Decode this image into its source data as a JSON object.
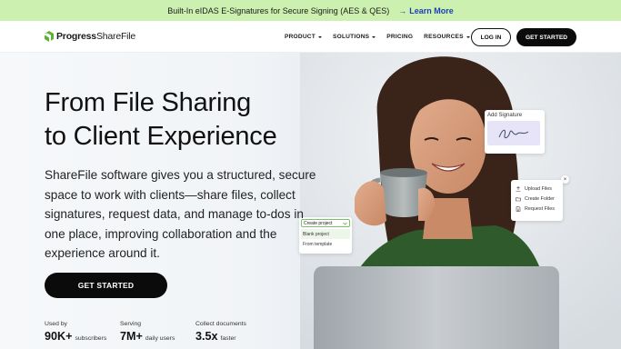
{
  "banner": {
    "message": "Built-In eIDAS E-Signatures for Secure Signing (AES & QES)",
    "link_label": "Learn More",
    "arrow": "→"
  },
  "nav": {
    "logo_primary": "Progress",
    "logo_secondary": "ShareFile",
    "menu": [
      {
        "label": "PRODUCT",
        "dropdown": true
      },
      {
        "label": "SOLUTIONS",
        "dropdown": true
      },
      {
        "label": "PRICING",
        "dropdown": false
      },
      {
        "label": "RESOURCES",
        "dropdown": true
      }
    ],
    "login_label": "LOG IN",
    "get_started_label": "GET STARTED"
  },
  "hero": {
    "headline_line1": "From File Sharing",
    "headline_line2": "to Client Experience",
    "lead": "ShareFile software gives you a structured, secure space to work with clients—share files, collect signatures, request data, and manage to-dos in one place, improving collaboration and the experience around it.",
    "cta_label": "GET STARTED",
    "stats": [
      {
        "caption": "Used by",
        "value": "90K+",
        "unit": "subscribers"
      },
      {
        "caption": "Serving",
        "value": "7M+",
        "unit": "daily users"
      },
      {
        "caption": "Collect documents",
        "value": "3.5x",
        "unit": "faster"
      }
    ]
  },
  "cards": {
    "signature": {
      "title": "Add Signature"
    },
    "upload": {
      "close": "×",
      "items": [
        {
          "icon": "upload-icon",
          "label": "Upload Files"
        },
        {
          "icon": "folder-icon",
          "label": "Create Folder"
        },
        {
          "icon": "request-icon",
          "label": "Request Files"
        }
      ]
    },
    "project": {
      "select_label": "Create project",
      "options": [
        "Blank project",
        "From template"
      ]
    }
  },
  "colors": {
    "banner_bg": "#ccf0b0",
    "brand_green": "#5ab334",
    "link_blue": "#1a3fb8",
    "button_black": "#0b0b0b"
  }
}
